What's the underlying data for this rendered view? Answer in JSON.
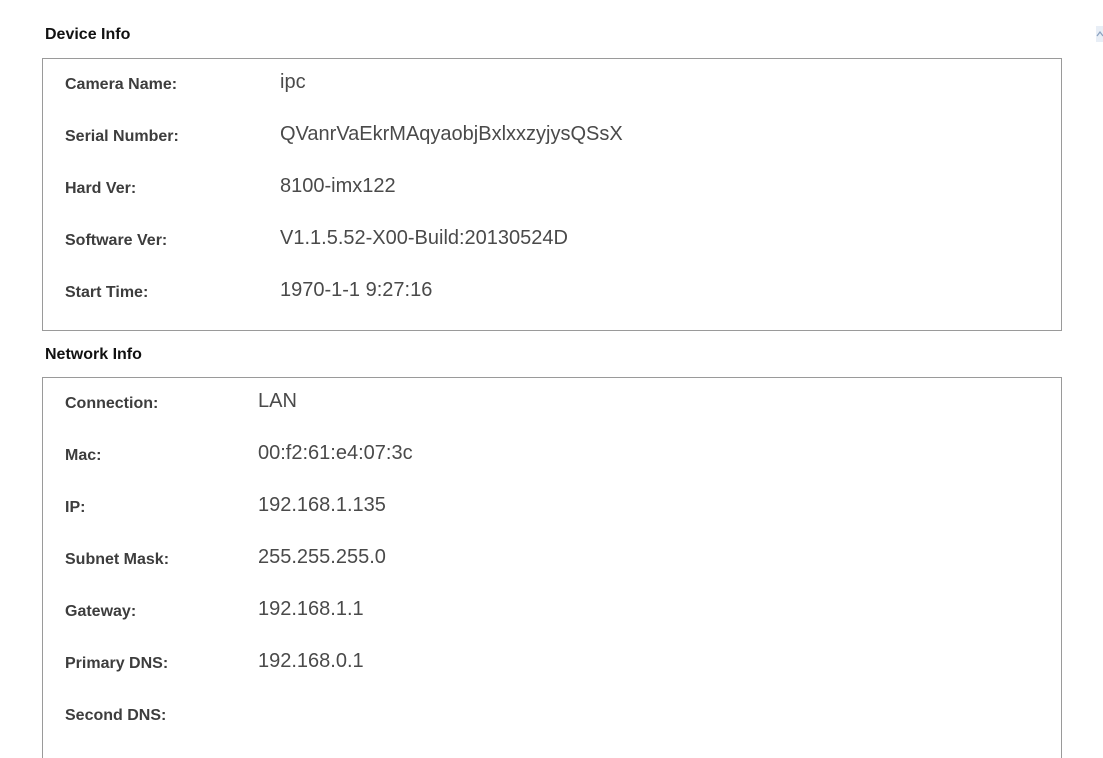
{
  "device_info": {
    "title": "Device Info",
    "fields": [
      {
        "label": "Camera Name:",
        "value": "ipc"
      },
      {
        "label": "Serial Number:",
        "value": "QVanrVaEkrMAqyaobjBxlxxzyjysQSsX"
      },
      {
        "label": "Hard Ver:",
        "value": "8100-imx122"
      },
      {
        "label": "Software Ver:",
        "value": "V1.1.5.52-X00-Build:20130524D"
      },
      {
        "label": "Start Time:",
        "value": "1970-1-1 9:27:16"
      }
    ]
  },
  "network_info": {
    "title": "Network Info",
    "fields": [
      {
        "label": "Connection:",
        "value": "LAN"
      },
      {
        "label": "Mac:",
        "value": "00:f2:61:e4:07:3c"
      },
      {
        "label": "IP:",
        "value": "192.168.1.135"
      },
      {
        "label": "Subnet Mask:",
        "value": "255.255.255.0"
      },
      {
        "label": "Gateway:",
        "value": "192.168.1.1"
      },
      {
        "label": "Primary DNS:",
        "value": "192.168.0.1"
      },
      {
        "label": "Second DNS:",
        "value": ""
      }
    ]
  },
  "colors": {
    "border": "#9a9a9a",
    "label_text": "#3d3d3d",
    "value_text": "#4a4a4a",
    "heading_text": "#111111"
  }
}
